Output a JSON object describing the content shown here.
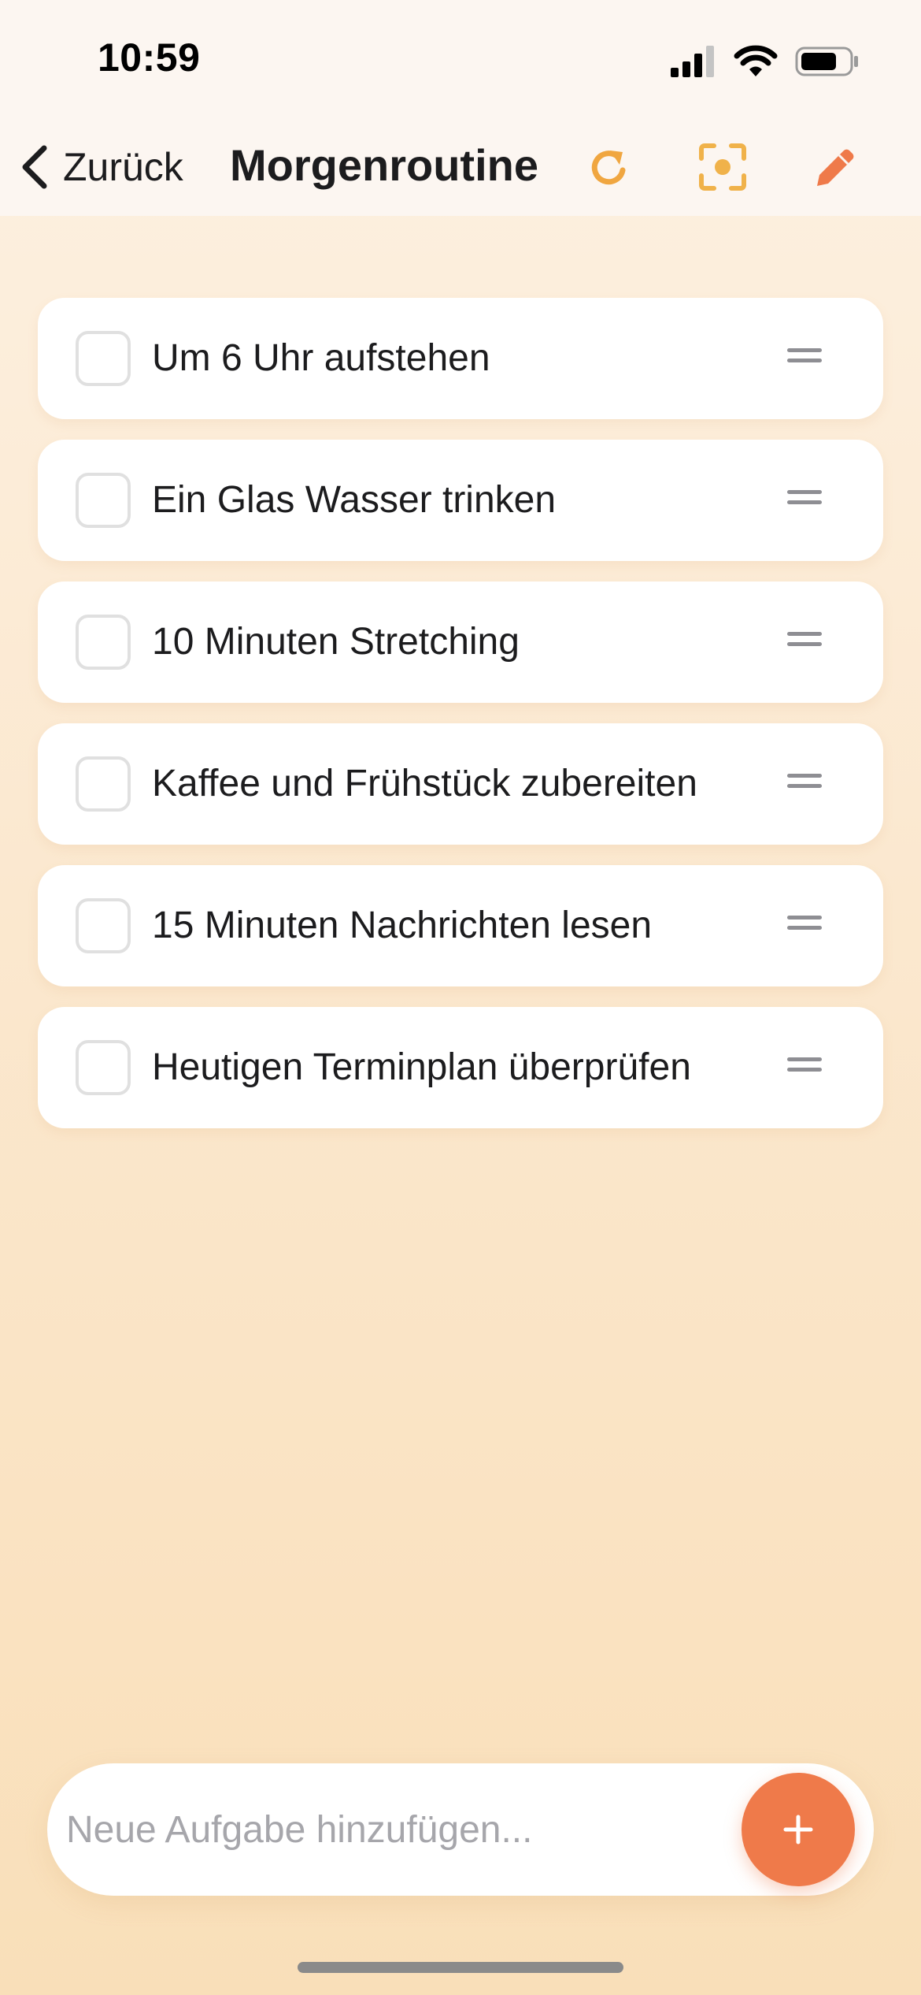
{
  "status_bar": {
    "time": "10:59"
  },
  "nav": {
    "back_label": "Zurück",
    "title": "Morgenroutine",
    "icons": [
      "chevron-left-icon",
      "refresh-icon",
      "focus-icon",
      "edit-pencil-icon"
    ]
  },
  "tasks": [
    {
      "text": "Um 6 Uhr aufstehen",
      "done": false
    },
    {
      "text": "Ein Glas Wasser trinken",
      "done": false
    },
    {
      "text": "10 Minuten Stretching",
      "done": false
    },
    {
      "text": "Kaffee und Frühstück zubereiten",
      "done": false
    },
    {
      "text": "15 Minuten Nachrichten lesen",
      "done": false
    },
    {
      "text": "Heutigen Terminplan überprüfen",
      "done": false
    }
  ],
  "add_task": {
    "placeholder": "Neue Aufgabe hinzufügen...",
    "value": ""
  },
  "colors": {
    "accent": "#ef7a4a",
    "refresh_icon": "#f0a640",
    "focus_icon": "#f0b24a",
    "edit_icon": "#ef7a4a"
  }
}
